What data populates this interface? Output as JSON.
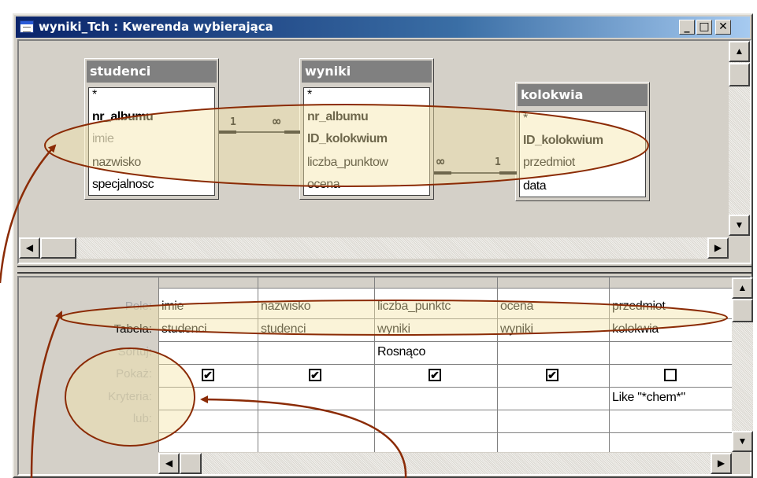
{
  "window": {
    "title": "wyniki_Tch : Kwerenda wybierająca",
    "minimize_glyph": "_",
    "maximize_glyph": "□",
    "close_glyph": "✕"
  },
  "tables": [
    {
      "name": "studenci",
      "fields": [
        "*",
        "nr_albumu",
        "imie",
        "nazwisko",
        "specjalnosc"
      ]
    },
    {
      "name": "wyniki",
      "fields": [
        "*",
        "nr_albumu",
        "ID_kolokwium",
        "liczba_punktow",
        "ocena"
      ]
    },
    {
      "name": "kolokwia",
      "fields": [
        "*",
        "ID_kolokwium",
        "przedmiot",
        "data"
      ]
    }
  ],
  "joins": [
    {
      "one": "1",
      "many": "∞"
    },
    {
      "one": "1",
      "many": "∞"
    }
  ],
  "grid": {
    "row_labels": [
      "Pole:",
      "Tabela:",
      "Sortuj:",
      "Pokaż:",
      "Kryteria:",
      "lub:"
    ],
    "columns": [
      {
        "pole": "imie",
        "tabela": "studenci",
        "sortuj": "",
        "pokaz": true,
        "kryteria": ""
      },
      {
        "pole": "nazwisko",
        "tabela": "studenci",
        "sortuj": "",
        "pokaz": true,
        "kryteria": ""
      },
      {
        "pole": "liczba_punktc",
        "tabela": "wyniki",
        "sortuj": "Rosnąco",
        "pokaz": true,
        "kryteria": ""
      },
      {
        "pole": "ocena",
        "tabela": "wyniki",
        "sortuj": "",
        "pokaz": true,
        "kryteria": ""
      },
      {
        "pole": "przedmiot",
        "tabela": "kolokwia",
        "sortuj": "",
        "pokaz": false,
        "kryteria": "Like \"*chem*\""
      }
    ]
  },
  "colors": {
    "annotation": "#8b2b05",
    "highlight_fill": "#f4e4a8",
    "title_start": "#0a246a",
    "title_end": "#a6caf0",
    "table_header": "#808080"
  },
  "icons": {
    "scroll_up": "▲",
    "scroll_down": "▼",
    "scroll_left": "◀",
    "scroll_right": "▶",
    "check": "✔"
  }
}
